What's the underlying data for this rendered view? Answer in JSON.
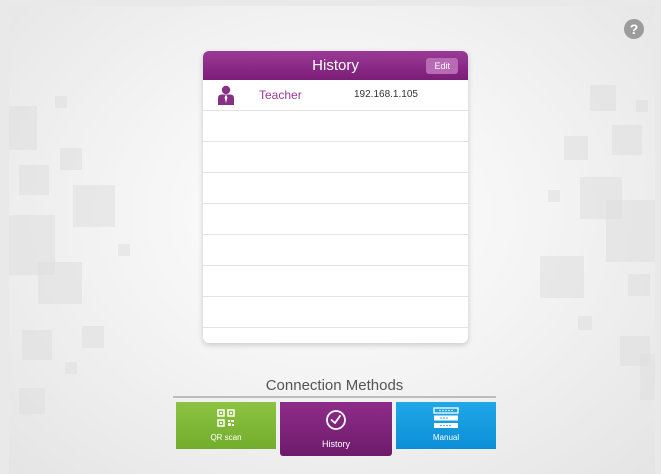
{
  "help": {
    "glyph": "?"
  },
  "history": {
    "title": "History",
    "edit_label": "Edit",
    "items": [
      {
        "name": "Teacher",
        "ip": "192.168.1.105",
        "icon": "person-icon"
      }
    ]
  },
  "connection": {
    "title": "Connection Methods",
    "buttons": {
      "qr": {
        "label": "QR scan",
        "icon": "qr-code-icon",
        "color": "#7fb636"
      },
      "history": {
        "label": "History",
        "icon": "clock-icon",
        "color": "#7e2279"
      },
      "manual": {
        "label": "Manual",
        "icon": "keypad-icon",
        "color": "#1a9fe3"
      }
    }
  },
  "colors": {
    "accent": "#8a2f86",
    "green": "#7fb636",
    "blue": "#1a9fe3"
  }
}
